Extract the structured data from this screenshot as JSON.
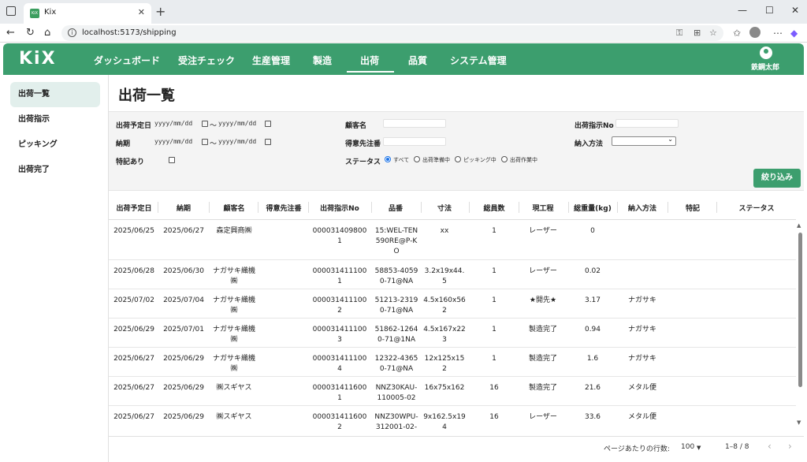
{
  "browser": {
    "tab_title": "Kix",
    "tab_icon": "kix-favicon",
    "url": "localhost:5173/shipping"
  },
  "app": {
    "logo": "KiX",
    "brand_color": "#3c9e6e",
    "nav": [
      {
        "label": "ダッシュボード"
      },
      {
        "label": "受注チェック"
      },
      {
        "label": "生産管理"
      },
      {
        "label": "製造"
      },
      {
        "label": "出荷"
      },
      {
        "label": "品質"
      },
      {
        "label": "システム管理"
      }
    ],
    "active_nav": "出荷",
    "user_name": "鉄鋼太郎"
  },
  "sidebar": {
    "items": [
      {
        "label": "出荷一覧"
      },
      {
        "label": "出荷指示"
      },
      {
        "label": "ピッキング"
      },
      {
        "label": "出荷完了"
      }
    ]
  },
  "page": {
    "title": "出荷一覧"
  },
  "filters": {
    "planned_date_label": "出荷予定日",
    "delivery_label": "納期",
    "special_label": "特記あり",
    "date_placeholder": "yyyy/mm/dd",
    "tilde": "～",
    "customer_label": "顧客名",
    "dest_label": "得意先注番",
    "status_label": "ステータス",
    "status_options": [
      {
        "label": "すべて",
        "checked": true
      },
      {
        "label": "出荷準備中",
        "checked": false
      },
      {
        "label": "ピッキング中",
        "checked": false
      },
      {
        "label": "出荷作業中",
        "checked": false
      }
    ],
    "instruction_label": "出荷指示No",
    "delivery_method_label": "納入方法",
    "delivery_method_value": "",
    "submit_label": "絞り込み"
  },
  "table": {
    "headers": [
      "出荷予定日",
      "納期",
      "顧客名",
      "得意先注番",
      "出荷指示No",
      "品番",
      "寸法",
      "総員数",
      "現工程",
      "総重量(kg)",
      "納入方法",
      "特記",
      "ステータス"
    ],
    "rows": [
      [
        "2025/06/25",
        "2025/06/27",
        "森定興商㈱",
        "",
        "0000314098001",
        "15:WEL-TEN590RE@P-KO",
        "xx",
        "1",
        "レーザー",
        "0",
        "",
        "",
        ""
      ],
      [
        "2025/06/28",
        "2025/06/30",
        "ナガサキ織機㈱",
        "",
        "0000314111001",
        "58853-40590-71@NA",
        "3.2x19x44.5",
        "1",
        "レーザー",
        "0.02",
        "",
        "",
        ""
      ],
      [
        "2025/07/02",
        "2025/07/04",
        "ナガサキ織機㈱",
        "",
        "0000314111002",
        "51213-23190-71@NA",
        "4.5x160x562",
        "1",
        "★開先★",
        "3.17",
        "ナガサキ",
        "",
        ""
      ],
      [
        "2025/06/29",
        "2025/07/01",
        "ナガサキ織機㈱",
        "",
        "0000314111003",
        "51862-12640-71@1NA",
        "4.5x167x223",
        "1",
        "製造完了",
        "0.94",
        "ナガサキ",
        "",
        ""
      ],
      [
        "2025/06/27",
        "2025/06/29",
        "ナガサキ織機㈱",
        "",
        "0000314111004",
        "12322-43650-71@NA",
        "12x125x152",
        "1",
        "製造完了",
        "1.6",
        "ナガサキ",
        "",
        ""
      ],
      [
        "2025/06/27",
        "2025/06/29",
        "㈱スギヤス",
        "",
        "0000314116001",
        "NNZ30KAU-110005-02",
        "16x75x162",
        "16",
        "製造完了",
        "21.6",
        "メタル便",
        "",
        ""
      ],
      [
        "2025/06/27",
        "2025/06/29",
        "㈱スギヤス",
        "",
        "0000314116002",
        "NNZ30WPU-312001-02-",
        "9x162.5x194",
        "16",
        "レーザー",
        "33.6",
        "メタル便",
        "",
        ""
      ]
    ]
  },
  "pager": {
    "rows_per_page_label": "ページあたりの行数:",
    "rows_per_page": "100",
    "range": "1–8 / 8"
  }
}
